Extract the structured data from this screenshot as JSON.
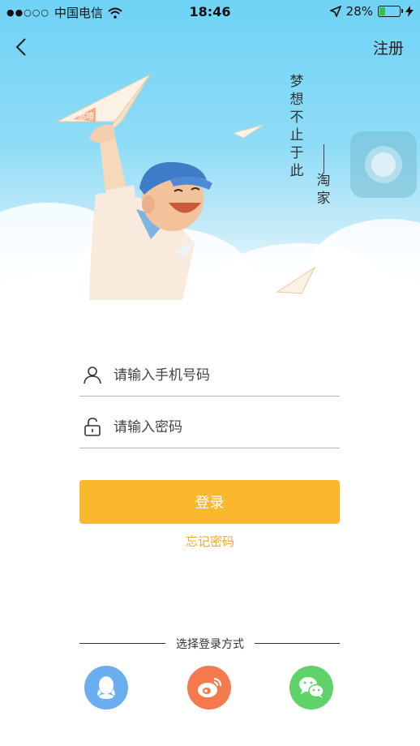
{
  "status_bar": {
    "signal": "●●○○○",
    "carrier": "中国电信",
    "wifi_icon": "wifi-icon",
    "time": "18:46",
    "location_icon": "location-arrow-icon",
    "battery_percent": "28%",
    "battery_level": 0.28,
    "charging_icon": "charging-bolt-icon"
  },
  "nav": {
    "back_icon": "chevron-left-icon",
    "register_label": "注册"
  },
  "hero": {
    "slogan": [
      "梦",
      "想",
      "不",
      "止",
      "于",
      "此"
    ],
    "slogan_author": [
      "淘",
      "家"
    ],
    "plane_text": "悠嘻"
  },
  "form": {
    "phone_placeholder": "请输入手机号码",
    "password_placeholder": "请输入密码",
    "login_label": "登录",
    "forgot_label": "忘记密码"
  },
  "social_login": {
    "title": "选择登录方式",
    "options": [
      {
        "icon": "qq-icon",
        "color": "#6aaef0"
      },
      {
        "icon": "weibo-icon",
        "color": "#f47a4e"
      },
      {
        "icon": "wechat-icon",
        "color": "#5fd26a"
      }
    ]
  },
  "colors": {
    "accent": "#fbb82c",
    "forgot": "#f5a623",
    "sky": "#6fd3f5"
  }
}
